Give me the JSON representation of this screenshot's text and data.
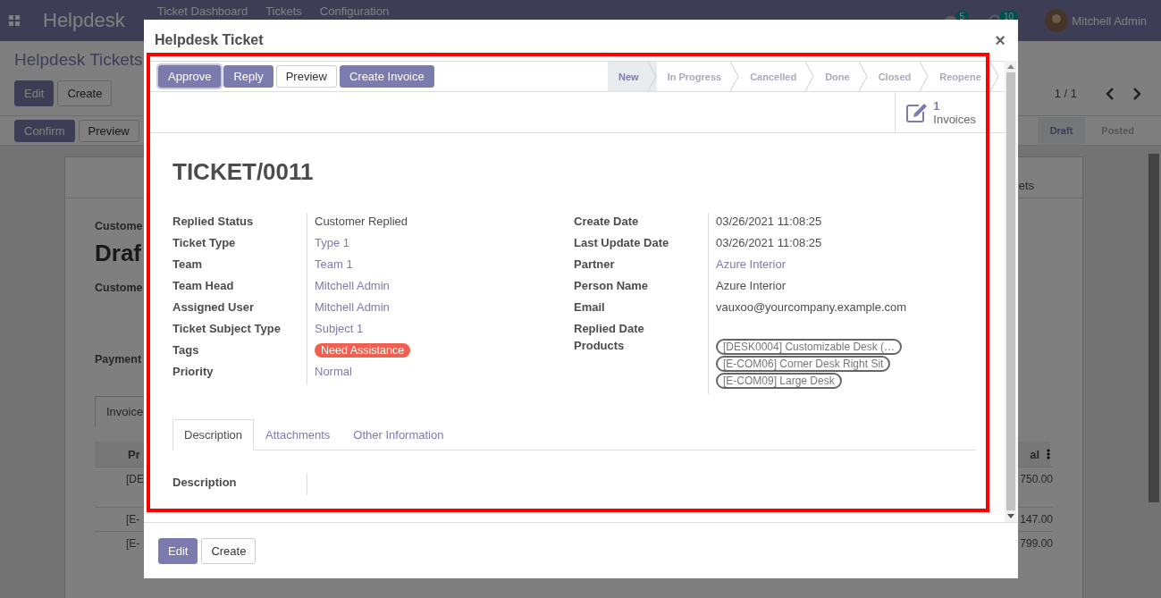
{
  "navbar": {
    "app_name": "Helpdesk",
    "menu": [
      "Ticket Dashboard",
      "Tickets",
      "Configuration"
    ],
    "chat_badge": "5",
    "activity_badge": "10",
    "user": "Mitchell Admin"
  },
  "background": {
    "breadcrumb": "Helpdesk Tickets",
    "buttons": [
      {
        "label": "Edit",
        "kind": "primary"
      },
      {
        "label": "Create",
        "kind": "secondary"
      }
    ],
    "pager": "1 / 1",
    "status_buttons": [
      {
        "label": "Confirm",
        "kind": "primary"
      },
      {
        "label": "Preview",
        "kind": "secondary"
      }
    ],
    "stages": [
      {
        "label": "Draft",
        "selected": true
      },
      {
        "label": "Posted",
        "selected": false
      }
    ],
    "tab_fragment": "ets",
    "label_1": "Custome",
    "state": "Draf",
    "label_2": "Custome",
    "label_3": "Payment",
    "tab": "Invoice",
    "column_1": "Pr",
    "column_2": "al",
    "rows": [
      {
        "product": "[DE",
        "amount": "750.00"
      },
      {
        "product": "[E-",
        "amount": "147.00"
      },
      {
        "product": "[E-",
        "amount": "799.00"
      }
    ]
  },
  "modal": {
    "title": "Helpdesk Ticket",
    "close": "×",
    "actions": [
      {
        "label": "Approve",
        "kind": "primary"
      },
      {
        "label": "Reply",
        "kind": "primary"
      },
      {
        "label": "Preview",
        "kind": "secondary"
      },
      {
        "label": "Create Invoice",
        "kind": "primary"
      }
    ],
    "stages": [
      {
        "label": "New",
        "selected": true
      },
      {
        "label": "In Progress",
        "selected": false
      },
      {
        "label": "Cancelled",
        "selected": false
      },
      {
        "label": "Done",
        "selected": false
      },
      {
        "label": "Closed",
        "selected": false
      },
      {
        "label": "Reopene",
        "selected": false
      }
    ],
    "stat": {
      "value": "1",
      "label": "Invoices"
    },
    "name": "TICKET/0011",
    "left_fields": [
      {
        "label": "Replied Status",
        "kind": "text",
        "value": "Customer Replied"
      },
      {
        "label": "Ticket Type",
        "kind": "link",
        "value": "Type 1"
      },
      {
        "label": "Team",
        "kind": "link",
        "value": "Team 1"
      },
      {
        "label": "Team Head",
        "kind": "link",
        "value": "Mitchell Admin"
      },
      {
        "label": "Assigned User",
        "kind": "link",
        "value": "Mitchell Admin"
      },
      {
        "label": "Ticket Subject Type",
        "kind": "link",
        "value": "Subject 1"
      },
      {
        "label": "Tags",
        "kind": "tag",
        "value": "Need Assistance",
        "color": "#f06050"
      },
      {
        "label": "Priority",
        "kind": "link",
        "value": "Normal"
      }
    ],
    "right_fields": [
      {
        "label": "Create Date",
        "kind": "text",
        "value": "03/26/2021 11:08:25"
      },
      {
        "label": "Last Update Date",
        "kind": "text",
        "value": "03/26/2021 11:08:25"
      },
      {
        "label": "Partner",
        "kind": "link",
        "value": "Azure Interior"
      },
      {
        "label": "Person Name",
        "kind": "text",
        "value": "Azure Interior"
      },
      {
        "label": "Email",
        "kind": "text",
        "value": "vauxoo@yourcompany.example.com"
      },
      {
        "label": "Replied Date",
        "kind": "empty"
      },
      {
        "label": "Products",
        "kind": "chips",
        "values": [
          "[DESK0004] Customizable Desk (…",
          "[E-COM06] Corner Desk Right Sit",
          "[E-COM09] Large Desk"
        ]
      }
    ],
    "tabs": [
      {
        "label": "Description",
        "selected": true
      },
      {
        "label": "Attachments",
        "selected": false
      },
      {
        "label": "Other Information",
        "selected": false
      }
    ],
    "description_label": "Description",
    "footer_buttons": [
      {
        "label": "Edit",
        "kind": "primary"
      },
      {
        "label": "Create",
        "kind": "secondary"
      }
    ]
  }
}
